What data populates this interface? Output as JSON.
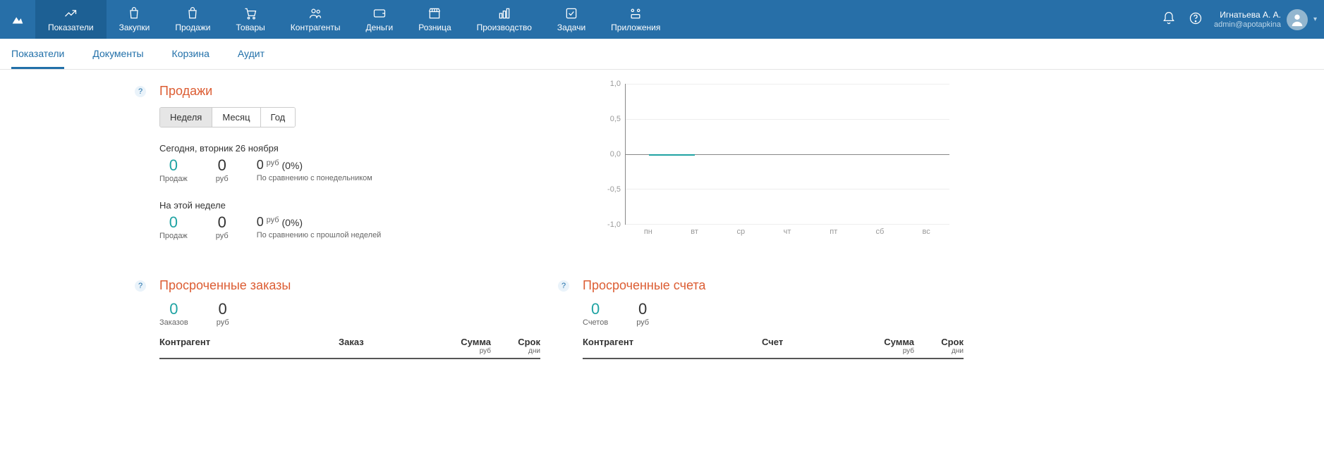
{
  "topnav": {
    "items": [
      {
        "label": "Показатели"
      },
      {
        "label": "Закупки"
      },
      {
        "label": "Продажи"
      },
      {
        "label": "Товары"
      },
      {
        "label": "Контрагенты"
      },
      {
        "label": "Деньги"
      },
      {
        "label": "Розница"
      },
      {
        "label": "Производство"
      },
      {
        "label": "Задачи"
      },
      {
        "label": "Приложения"
      }
    ]
  },
  "user": {
    "name": "Игнатьева А. А.",
    "email": "admin@apotapkina"
  },
  "subtabs": [
    {
      "label": "Показатели"
    },
    {
      "label": "Документы"
    },
    {
      "label": "Корзина"
    },
    {
      "label": "Аудит"
    }
  ],
  "sales": {
    "title": "Продажи",
    "periods": [
      {
        "label": "Неделя"
      },
      {
        "label": "Месяц"
      },
      {
        "label": "Год"
      }
    ],
    "today": {
      "heading": "Сегодня, вторник 26 ноября",
      "count": "0",
      "count_label": "Продаж",
      "sum": "0",
      "sum_label": "руб",
      "cmp_value": "0",
      "cmp_currency": "руб",
      "cmp_pct": "(0%)",
      "cmp_sub": "По сравнению с понедельником"
    },
    "week": {
      "heading": "На этой неделе",
      "count": "0",
      "count_label": "Продаж",
      "sum": "0",
      "sum_label": "руб",
      "cmp_value": "0",
      "cmp_currency": "руб",
      "cmp_pct": "(0%)",
      "cmp_sub": "По сравнению с прошлой неделей"
    }
  },
  "chart_data": {
    "type": "line",
    "title": "",
    "xlabel": "",
    "ylabel": "",
    "ylim": [
      -1.0,
      1.0
    ],
    "yticks": [
      -1.0,
      -0.5,
      0.0,
      0.5,
      1.0
    ],
    "categories": [
      "пн",
      "вт",
      "ср",
      "чт",
      "пт",
      "сб",
      "вс"
    ],
    "series": [
      {
        "name": "sales",
        "values": [
          0,
          0,
          null,
          null,
          null,
          null,
          null
        ]
      }
    ]
  },
  "overdue_orders": {
    "title": "Просроченные заказы",
    "count": "0",
    "count_label": "Заказов",
    "sum": "0",
    "sum_label": "руб",
    "columns": {
      "c1": "Контрагент",
      "c2": "Заказ",
      "c3": "Сумма",
      "c3_sub": "руб",
      "c4": "Срок",
      "c4_sub": "дни"
    }
  },
  "overdue_invoices": {
    "title": "Просроченные счета",
    "count": "0",
    "count_label": "Счетов",
    "sum": "0",
    "sum_label": "руб",
    "columns": {
      "c1": "Контрагент",
      "c2": "Счет",
      "c3": "Сумма",
      "c3_sub": "руб",
      "c4": "Срок",
      "c4_sub": "дни"
    }
  }
}
